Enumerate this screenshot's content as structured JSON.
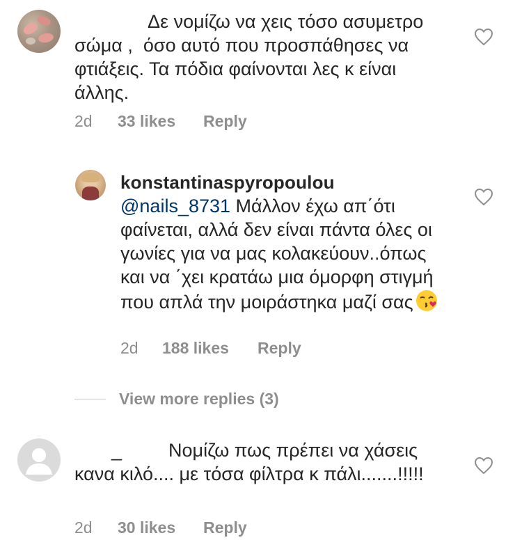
{
  "comments": [
    {
      "avatar": "nails-photo-avatar",
      "username": "",
      "text": "              Δε νομίζω να χεις τόσο ασυμετρο σώμα ,  όσο αυτό που προσπάθησες να φτιάξεις. Τα πόδια φαίνονται λες κ είναι άλλης.",
      "date": "2d",
      "likes": "33 likes",
      "reply": "Reply"
    },
    {
      "avatar": "profile-photo-avatar",
      "username": "konstantinaspyropoulou",
      "mention": "@nails_8731",
      "text": " Μάλλον έχω απ΄ότι φαίνεται, αλλά δεν είναι πάντα όλες οι γωνίες για να μας κολακεύουν..όπως και να ΄χει κρατάω μια όμορφη στιγμή που απλά την μοιράστηκα μαζί σας",
      "emoji": "kissing-face-emoji",
      "date": "2d",
      "likes": "188 likes",
      "reply": "Reply"
    },
    {
      "avatar": "default-avatar",
      "username": "_",
      "text": "                  Νομίζω πως πρέπει να χάσεις κανα κιλό.... με τόσα φίλτρα κ πάλι.......!!!!!",
      "date": "2d",
      "likes": "30 likes",
      "reply": "Reply"
    }
  ],
  "view_more": "View more replies (3)",
  "icons": {
    "like": "heart-outline-icon"
  },
  "colors": {
    "text": "#262626",
    "meta": "#8e8e8e",
    "mention": "#003569"
  }
}
